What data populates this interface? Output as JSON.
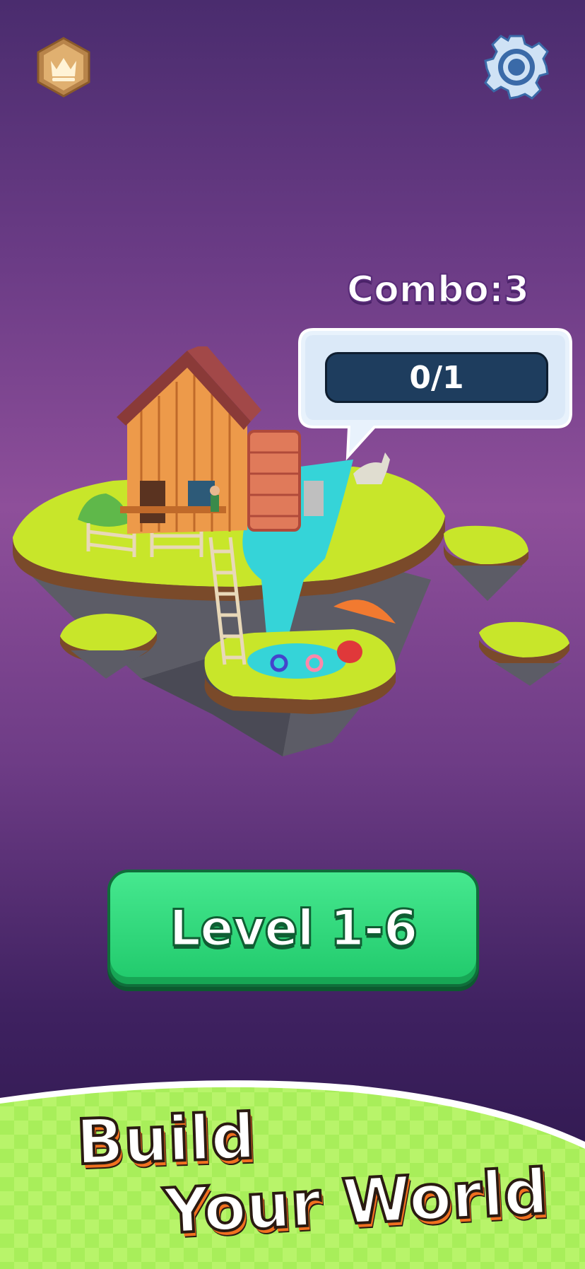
{
  "hud": {
    "crown_icon": "crown-icon",
    "settings_icon": "gear-icon",
    "combo_text": "Combo:3",
    "progress_text": "0/1"
  },
  "main": {
    "level_button_label": "Level 1-6"
  },
  "banner": {
    "line1": "Build",
    "line2": "Your World"
  },
  "colors": {
    "background_top": "#4a2c6e",
    "level_button": "#2ed47a",
    "progress_bar": "#1e3d5e",
    "ground": "#a8ee5a",
    "tagline_shadow": "#f07020"
  }
}
